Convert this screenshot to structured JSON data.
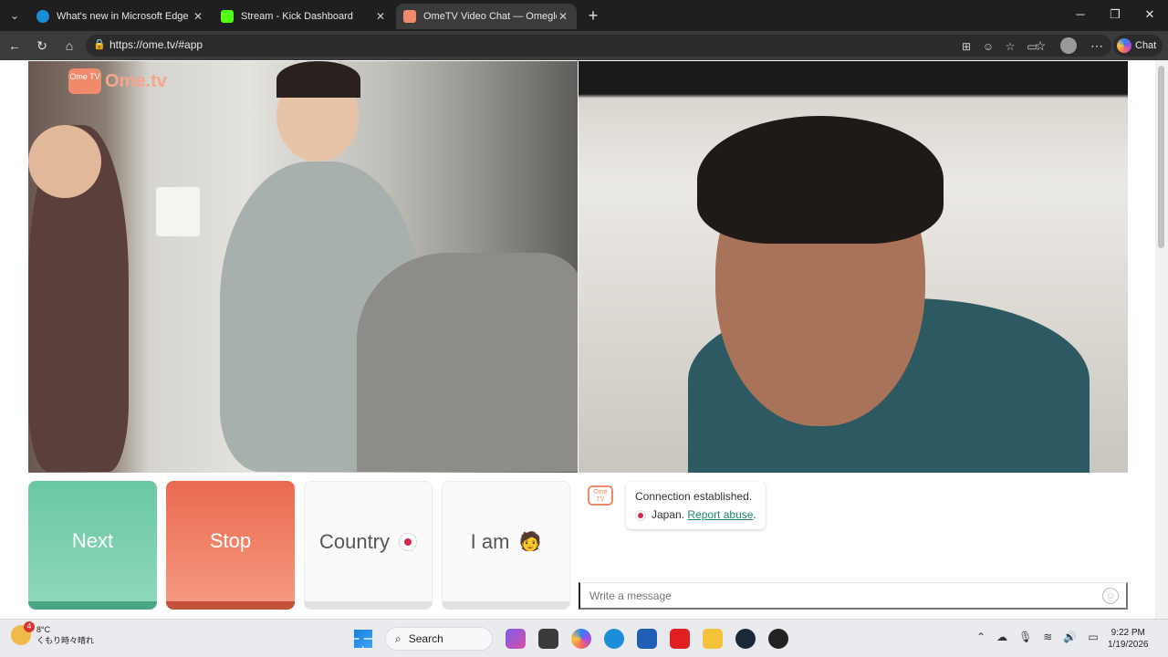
{
  "browser": {
    "tabs": [
      {
        "title": "What's new in Microsoft Edge",
        "favicon_color": "#1a8fd8"
      },
      {
        "title": "Stream - Kick Dashboard",
        "favicon_color": "#53fc18"
      },
      {
        "title": "OmeTV Video Chat — Omegle",
        "favicon_color": "#f08a6a"
      }
    ],
    "url": "https://ome.tv/#app",
    "chat_label": "Chat"
  },
  "site": {
    "logo_box": "Ome TV",
    "logo_text": "Ome.tv",
    "buttons": {
      "next": "Next",
      "stop": "Stop",
      "country": "Country",
      "i_am": "I am",
      "i_am_emoji": "🧑"
    },
    "chat": {
      "logo": "Ome TV",
      "message": "Connection established.",
      "country": "Japan.",
      "report": "Report abuse",
      "period": ".",
      "placeholder": "Write a message"
    }
  },
  "taskbar": {
    "weather_temp": "8°C",
    "weather_desc": "くもり時々晴れ",
    "weather_badge": "4",
    "search_label": "Search",
    "time": "9:22 PM",
    "date": "1/19/2026"
  }
}
